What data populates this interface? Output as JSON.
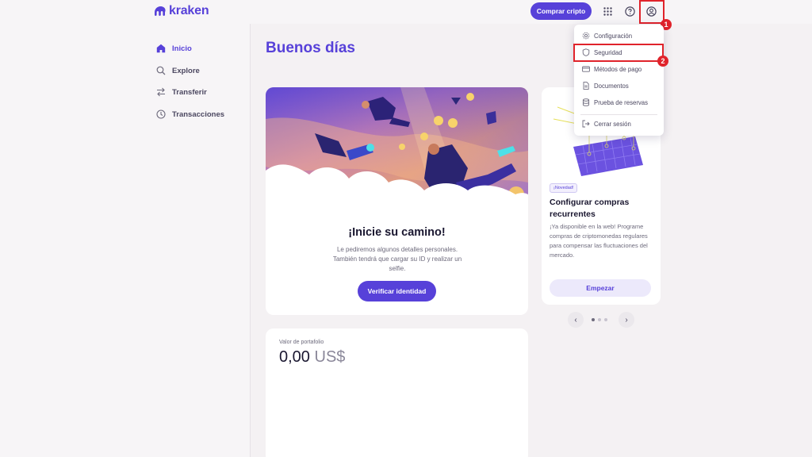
{
  "app": {
    "brand": "kraken",
    "accent": "#5741d9",
    "highlight": "#e0232b"
  },
  "topbar": {
    "buy_label": "Comprar cripto"
  },
  "sidebar": {
    "items": [
      {
        "label": "Inicio",
        "icon": "home-icon",
        "active": true
      },
      {
        "label": "Explore",
        "icon": "search-icon"
      },
      {
        "label": "Transferir",
        "icon": "transfer-icon"
      },
      {
        "label": "Transacciones",
        "icon": "clock-icon"
      }
    ]
  },
  "main": {
    "greeting": "Buenos días",
    "hero": {
      "title": "¡Inicie su camino!",
      "description": "Le pediremos algunos detalles personales. También tendrá que cargar su ID y realizar un selfie.",
      "button": "Verificar identidad"
    },
    "portfolio": {
      "label": "Valor de portafolio",
      "amount": "0,00",
      "currency": "US$"
    },
    "promo": {
      "badge": "¡Novedad!",
      "title": "Configurar compras recurrentes",
      "description": "¡Ya disponible en la web! Programe compras de criptomonedas regulares para compensar las fluctuaciones del mercado.",
      "button": "Empezar",
      "carousel_pages": 3,
      "carousel_active": 1
    }
  },
  "dropdown": {
    "items": [
      {
        "label": "Configuración",
        "icon": "gear-icon"
      },
      {
        "label": "Seguridad",
        "icon": "shield-icon"
      },
      {
        "label": "Métodos de pago",
        "icon": "card-icon"
      },
      {
        "label": "Documentos",
        "icon": "document-icon"
      },
      {
        "label": "Prueba de reservas",
        "icon": "database-icon"
      },
      {
        "label": "Cerrar sesión",
        "icon": "logout-icon"
      }
    ]
  },
  "annotations": {
    "step1": "1",
    "step2": "2"
  }
}
